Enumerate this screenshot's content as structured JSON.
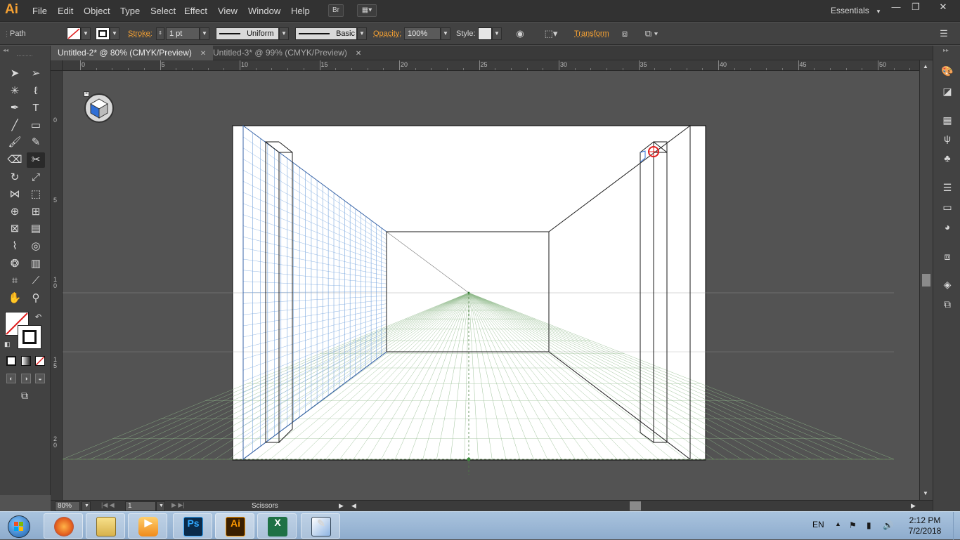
{
  "app": {
    "logo": "Ai",
    "menu": [
      "File",
      "Edit",
      "Object",
      "Type",
      "Select",
      "Effect",
      "View",
      "Window",
      "Help"
    ],
    "bridge_label": "Br",
    "workspace": "Essentials",
    "window_controls": [
      "—",
      "❐",
      "✕"
    ]
  },
  "control_bar": {
    "selection_type": "Path",
    "stroke_label": "Stroke:",
    "stroke_weight": "1 pt",
    "profile": "Uniform",
    "brush": "Basic",
    "opacity_label": "Opacity:",
    "opacity": "100%",
    "style_label": "Style:",
    "transform_label": "Transform"
  },
  "tabs": [
    {
      "label": "Untitled-2* @ 80% (CMYK/Preview)",
      "active": true
    },
    {
      "label": "Untitled-3* @ 99% (CMYK/Preview)",
      "active": false
    }
  ],
  "tab_close": "✕",
  "tools": [
    {
      "name": "selection-tool-icon",
      "glyph": "➤"
    },
    {
      "name": "direct-selection-tool-icon",
      "glyph": "➢"
    },
    {
      "name": "magic-wand-tool-icon",
      "glyph": "✳"
    },
    {
      "name": "lasso-tool-icon",
      "glyph": "ℓ"
    },
    {
      "name": "pen-tool-icon",
      "glyph": "✒"
    },
    {
      "name": "type-tool-icon",
      "glyph": "T"
    },
    {
      "name": "line-segment-tool-icon",
      "glyph": "╱"
    },
    {
      "name": "rectangle-tool-icon",
      "glyph": "▭"
    },
    {
      "name": "paintbrush-tool-icon",
      "glyph": "🖌"
    },
    {
      "name": "pencil-tool-icon",
      "glyph": "✎"
    },
    {
      "name": "eraser-tool-icon",
      "glyph": "⌫"
    },
    {
      "name": "scissors-tool-icon",
      "glyph": "✂"
    },
    {
      "name": "rotate-tool-icon",
      "glyph": "↻"
    },
    {
      "name": "scale-tool-icon",
      "glyph": "⤢"
    },
    {
      "name": "width-tool-icon",
      "glyph": "⋈"
    },
    {
      "name": "free-transform-tool-icon",
      "glyph": "⬚"
    },
    {
      "name": "shape-builder-tool-icon",
      "glyph": "⊕"
    },
    {
      "name": "perspective-grid-tool-icon",
      "glyph": "⊞"
    },
    {
      "name": "mesh-tool-icon",
      "glyph": "⊠"
    },
    {
      "name": "gradient-tool-icon",
      "glyph": "▤"
    },
    {
      "name": "eyedropper-tool-icon",
      "glyph": "⌇"
    },
    {
      "name": "blend-tool-icon",
      "glyph": "◎"
    },
    {
      "name": "symbol-sprayer-tool-icon",
      "glyph": "❂"
    },
    {
      "name": "column-graph-tool-icon",
      "glyph": "▥"
    },
    {
      "name": "artboard-tool-icon",
      "glyph": "⌗"
    },
    {
      "name": "slice-tool-icon",
      "glyph": "⟋"
    },
    {
      "name": "hand-tool-icon",
      "glyph": "✋"
    },
    {
      "name": "zoom-tool-icon",
      "glyph": "⚲"
    }
  ],
  "rulers": {
    "top": [
      "0",
      "5",
      "10",
      "15",
      "20",
      "25",
      "30",
      "35",
      "40",
      "45",
      "50"
    ],
    "left": [
      "0",
      "5",
      "1\n0",
      "1\n5",
      "2\n0"
    ]
  },
  "right_panel_icons": [
    "color-icon",
    "color-guide-icon",
    "swatches-icon",
    "brushes-icon",
    "symbols-icon",
    "stroke-icon",
    "gradient-icon",
    "transparency-icon",
    "appearance-icon",
    "layers-icon",
    "artboards-icon"
  ],
  "status_bar": {
    "zoom": "80%",
    "artboard": "1",
    "current_tool": "Scissors"
  },
  "taskbar": {
    "apps": [
      {
        "name": "start-orb",
        "label": ""
      },
      {
        "name": "firefox",
        "label": ""
      },
      {
        "name": "windows-explorer",
        "label": ""
      },
      {
        "name": "media-player",
        "label": ""
      },
      {
        "name": "photoshop",
        "label": "Ps"
      },
      {
        "name": "illustrator",
        "label": "Ai"
      },
      {
        "name": "excel",
        "label": "X"
      },
      {
        "name": "paint",
        "label": ""
      }
    ],
    "language": "EN",
    "time": "2:12 PM",
    "date": "7/2/2018"
  },
  "colors": {
    "accent": "#f7a233",
    "grid_left": "#7aa7de",
    "grid_floor": "#8fb98a",
    "lines": "#1a1a1a"
  }
}
